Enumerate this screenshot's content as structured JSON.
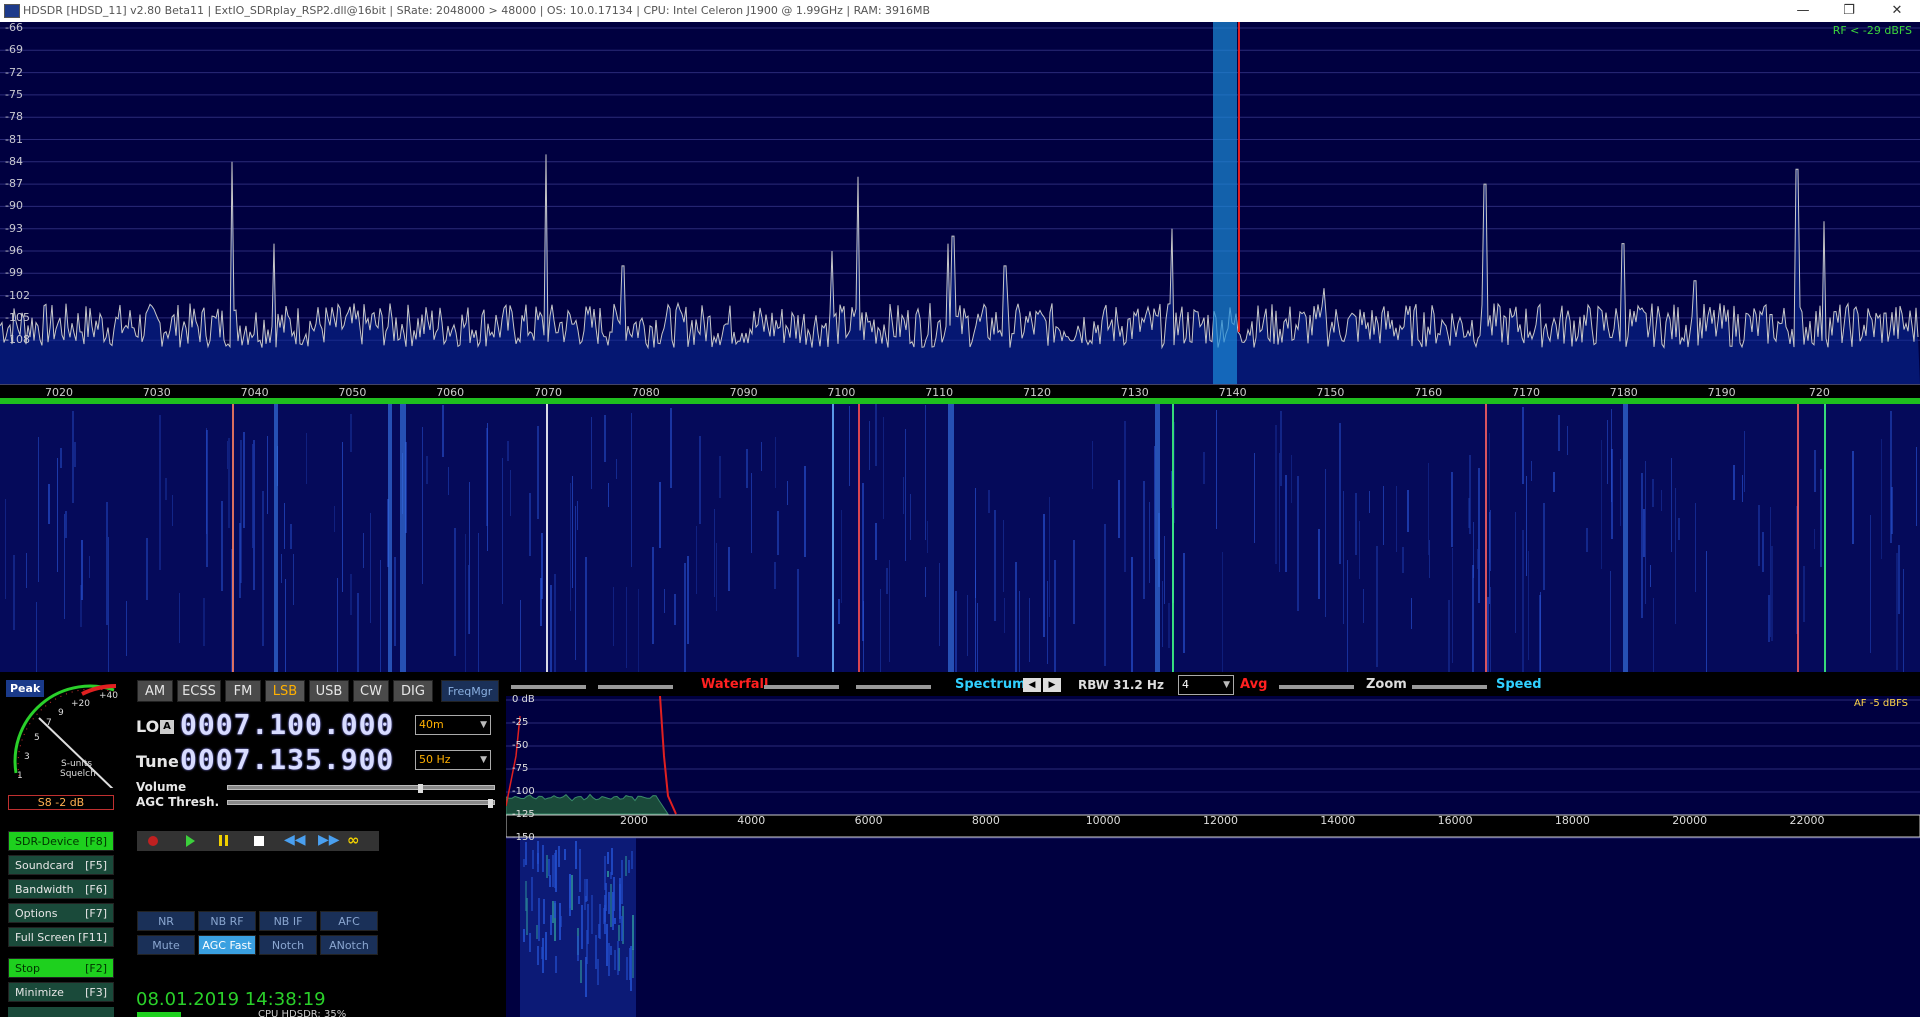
{
  "window": {
    "title": "HDSDR  [HDSD_11]  v2.80 Beta11  |  ExtIO_SDRplay_RSP2.dll@16bit  |  SRate: 2048000 > 48000  |  OS: 10.0.17134   |  CPU: Intel Celeron  J1900  @ 1.99GHz  |  RAM: 3916MB",
    "minimize": "—",
    "restore": "❐",
    "close": "✕"
  },
  "spectrum": {
    "y_labels": [
      "-66",
      "-69",
      "-72",
      "-75",
      "-78",
      "-81",
      "-84",
      "-87",
      "-90",
      "-93",
      "-96",
      "-99",
      "-102",
      "-105",
      "-108"
    ],
    "rf_readout": "RF < -29 dBFS",
    "freq_labels": [
      "7020",
      "7030",
      "7040",
      "7050",
      "7060",
      "7070",
      "7080",
      "7090",
      "7100",
      "7110",
      "7120",
      "7130",
      "7140",
      "7150",
      "7160",
      "7170",
      "7180",
      "7190",
      "720"
    ]
  },
  "meter": {
    "peak_label": "Peak",
    "scale": [
      "1",
      "3",
      "5",
      "7",
      "9",
      "+20",
      "+40"
    ],
    "s_units": "S-units",
    "squelch": "Squelch",
    "reading": "S8 -2 dB"
  },
  "modes": [
    "AM",
    "ECSS",
    "FM",
    "LSB",
    "USB",
    "CW",
    "DIG"
  ],
  "active_mode": "LSB",
  "freqmgr": "FreqMgr",
  "lo": {
    "label": "LO",
    "badge": "A",
    "value": "0007.100.000",
    "band": "40m"
  },
  "tune": {
    "label": "Tune",
    "value": "0007.135.900",
    "step": "50 Hz"
  },
  "volume_label": "Volume",
  "agc_label": "AGC Thresh.",
  "side_buttons": [
    {
      "label": "SDR-Device",
      "key": "[F8]",
      "on": true
    },
    {
      "label": "Soundcard",
      "key": "[F5]",
      "on": false
    },
    {
      "label": "Bandwidth",
      "key": "[F6]",
      "on": false
    },
    {
      "label": "Options",
      "key": "[F7]",
      "on": false
    },
    {
      "label": "Full Screen",
      "key": "[F11]",
      "on": false
    },
    {
      "label": "Stop",
      "key": "[F2]",
      "on": true
    },
    {
      "label": "Minimize",
      "key": "[F3]",
      "on": false
    }
  ],
  "dsp_row1": [
    "NR",
    "NB RF",
    "NB IF",
    "AFC"
  ],
  "dsp_row2": [
    "Mute",
    "AGC Fast",
    "Notch",
    "ANotch"
  ],
  "datetime": "08.01.2019 14:38:19",
  "cpu_text": "CPU HDSDR: 35%",
  "top_controls": {
    "waterfall": "Waterfall",
    "spectrum": "Spectrum",
    "rbw": "RBW 31.2 Hz",
    "avg_value": "4",
    "avg": "Avg",
    "zoom": "Zoom",
    "speed": "Speed"
  },
  "af": {
    "y_labels": [
      "0 dB",
      "-25",
      "-50",
      "-75",
      "-100",
      "-125",
      "-150"
    ],
    "x_labels": [
      "2000",
      "4000",
      "6000",
      "8000",
      "10000",
      "12000",
      "14000",
      "16000",
      "18000",
      "20000",
      "22000"
    ],
    "readout": "AF  -5 dBFS"
  }
}
